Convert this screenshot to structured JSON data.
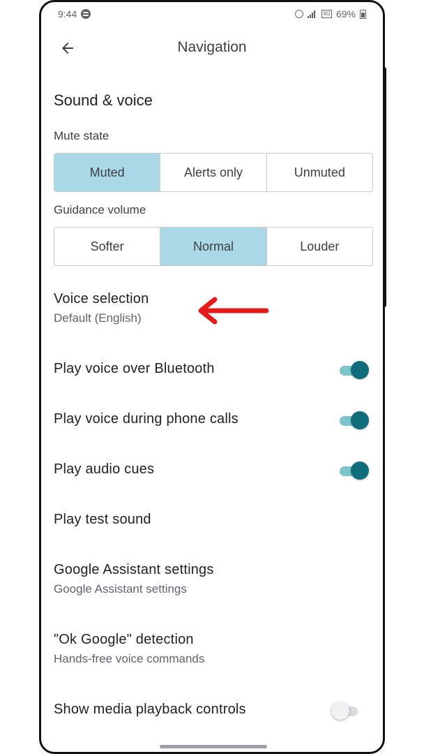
{
  "status_bar": {
    "time": "9:44",
    "battery": "69%"
  },
  "app_bar": {
    "title": "Navigation"
  },
  "section": {
    "title": "Sound & voice"
  },
  "mute_state": {
    "label": "Mute state",
    "options": [
      "Muted",
      "Alerts only",
      "Unmuted"
    ],
    "selected": "Muted"
  },
  "guidance_volume": {
    "label": "Guidance volume",
    "options": [
      "Softer",
      "Normal",
      "Louder"
    ],
    "selected": "Normal"
  },
  "voice_selection": {
    "title": "Voice selection",
    "subtitle": "Default (English)"
  },
  "toggles": {
    "bluetooth": {
      "label": "Play voice over Bluetooth",
      "on": true
    },
    "phone_calls": {
      "label": "Play voice during phone calls",
      "on": true
    },
    "audio_cues": {
      "label": "Play audio cues",
      "on": true
    },
    "media_controls": {
      "label": "Show media playback controls",
      "on": false
    }
  },
  "test_sound": {
    "title": "Play test sound"
  },
  "assistant_settings": {
    "title": "Google Assistant settings",
    "subtitle": "Google Assistant settings"
  },
  "ok_google": {
    "title": "\"Ok Google\" detection",
    "subtitle": "Hands-free voice commands"
  },
  "colors": {
    "selected_segment": "#aad8e6",
    "toggle_on_thumb": "#0f6c7a",
    "toggle_on_track": "#7dc4c9",
    "annotation_arrow": "#e31b1b"
  },
  "icons": {
    "back": "arrow-left-icon",
    "annotation": "red-arrow-icon"
  }
}
